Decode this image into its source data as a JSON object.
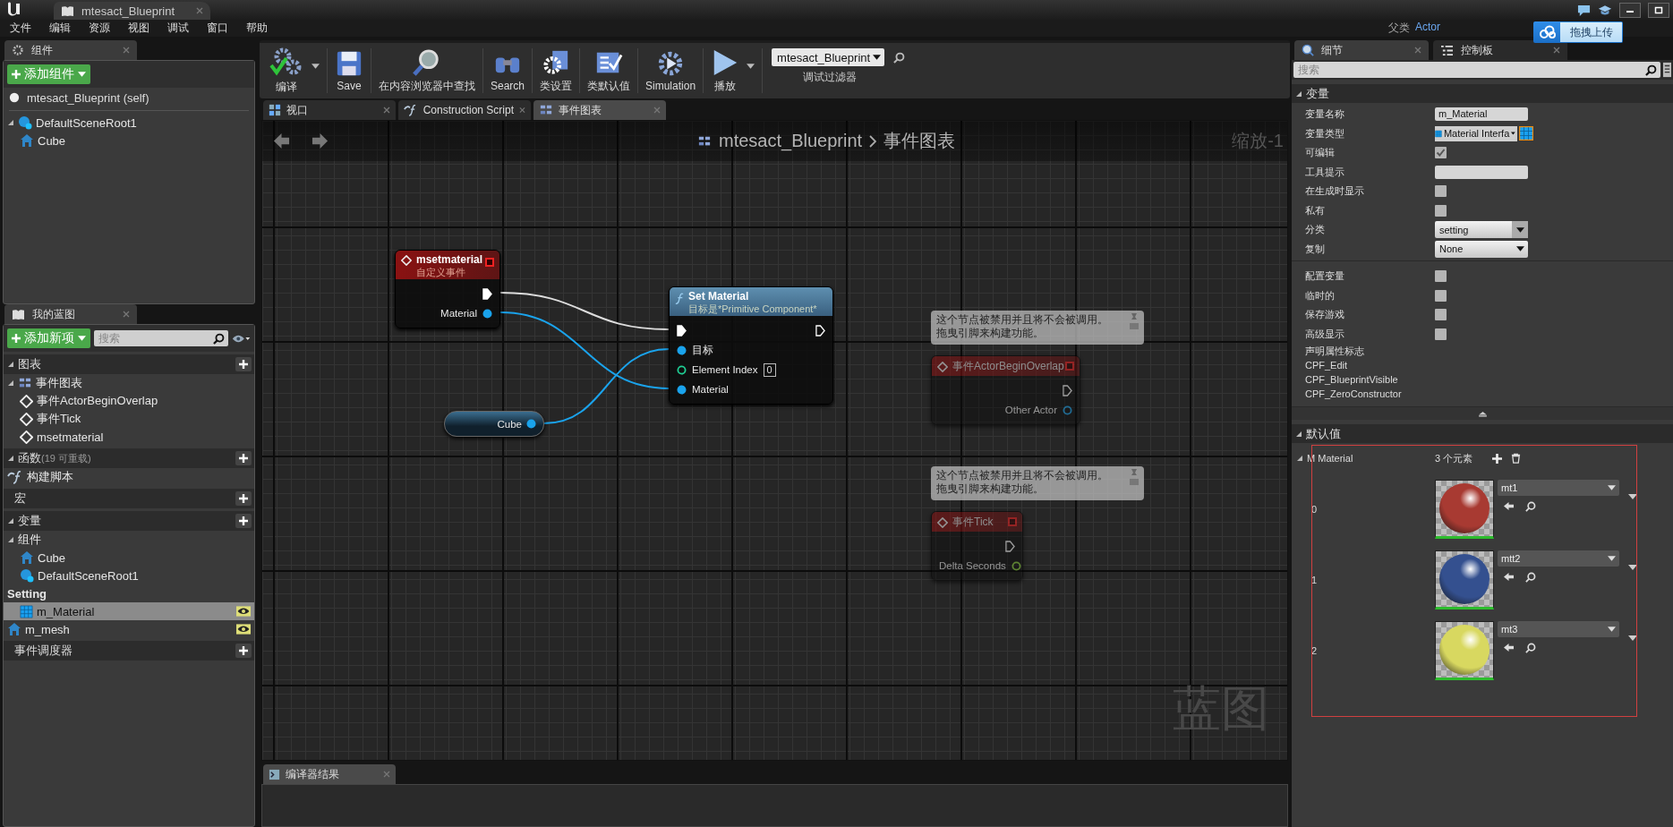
{
  "title_bar": {
    "document_tab": "mtesact_Blueprint"
  },
  "menu": [
    "文件",
    "编辑",
    "资源",
    "视图",
    "调试",
    "窗口",
    "帮助"
  ],
  "parent_class": {
    "label": "父类",
    "value": "Actor"
  },
  "upload_widget": {
    "label": "拖拽上传"
  },
  "components": {
    "tab": "组件",
    "add_button": "添加组件",
    "self_item": "mtesact_Blueprint (self)",
    "tree": [
      {
        "label": "DefaultSceneRoot1",
        "kind": "scene",
        "expanded": true,
        "selected": false,
        "children": [
          {
            "label": "Cube",
            "kind": "mesh",
            "selected": false
          }
        ]
      }
    ]
  },
  "my_blueprint": {
    "tab": "我的蓝图",
    "add_button": "添加新项",
    "search": {
      "placeholder": "搜索"
    },
    "sections": [
      {
        "title": "图表",
        "expanded": true,
        "rows": [
          {
            "label": "事件图表",
            "kind": "graph",
            "expanded": true,
            "selected": false,
            "children": [
              {
                "label": "事件ActorBeginOverlap",
                "kind": "event",
                "selected": false
              },
              {
                "label": "事件Tick",
                "kind": "event",
                "selected": false
              },
              {
                "label": "msetmaterial",
                "kind": "custom-event",
                "selected": false
              }
            ]
          }
        ]
      },
      {
        "title": "函数",
        "note": "(19 可重载)",
        "expanded": true,
        "rows": [
          {
            "label": "构建脚本",
            "kind": "function",
            "selected": false
          }
        ]
      },
      {
        "title": "宏"
      },
      {
        "title": "变量",
        "expanded": true,
        "rows": [
          {
            "label": "组件",
            "kind": "category",
            "expanded": true,
            "children": [
              {
                "label": "Cube",
                "kind": "mesh",
                "selected": false,
                "exposed": false
              },
              {
                "label": "DefaultSceneRoot1",
                "kind": "scene",
                "selected": false,
                "exposed": false
              }
            ]
          },
          {
            "label": "Setting",
            "kind": "user-category",
            "children": [
              {
                "label": "m_Material",
                "kind": "material",
                "selected": true,
                "exposed": true
              }
            ]
          },
          {
            "label": "m_mesh",
            "kind": "mesh",
            "selected": false,
            "exposed": true
          }
        ]
      },
      {
        "title": "事件调度器"
      }
    ]
  },
  "toolbar": {
    "buttons": [
      {
        "label": "编译",
        "kind": "compile",
        "has_menu": true
      },
      {
        "label": "Save",
        "kind": "save",
        "has_menu": false
      },
      {
        "label": "在内容浏览器中查找",
        "kind": "browse",
        "has_menu": false
      },
      {
        "label": "Search",
        "kind": "search",
        "has_menu": false
      },
      {
        "label": "类设置",
        "kind": "class-settings",
        "has_menu": false
      },
      {
        "label": "类默认值",
        "kind": "class-defaults",
        "has_menu": false
      },
      {
        "label": "Simulation",
        "kind": "simulation",
        "has_menu": false
      },
      {
        "label": "播放",
        "kind": "play",
        "has_menu": true
      }
    ],
    "debug_filter": {
      "value": "mtesact_Blueprint",
      "label": "调试过滤器"
    }
  },
  "document_tabs": [
    {
      "label": "视口",
      "kind": "viewport",
      "selected": false
    },
    {
      "label": "Construction Script",
      "kind": "function",
      "selected": false
    },
    {
      "label": "事件图表",
      "kind": "graph",
      "selected": true
    }
  ],
  "graph": {
    "breadcrumb": [
      "mtesact_Blueprint",
      "事件图表"
    ],
    "zoom": "缩放-1",
    "corner_label": "蓝图",
    "nodes": [
      {
        "kind": "custom-event",
        "disabled": false,
        "title": "msetmaterial",
        "subtitle": "自定义事件",
        "outputs": [
          {
            "kind": "exec",
            "connected": true
          },
          {
            "kind": "object",
            "label": "Material",
            "connected": true
          }
        ]
      },
      {
        "kind": "function",
        "disabled": false,
        "title": "Set Material",
        "subtitle": "目标是*Primitive Component*",
        "inputs": [
          {
            "kind": "exec",
            "connected": true
          },
          {
            "kind": "object",
            "label": "目标",
            "connected": true
          },
          {
            "kind": "int",
            "label": "Element Index",
            "value": "0",
            "connected": false
          },
          {
            "kind": "object",
            "label": "Material",
            "connected": true
          }
        ],
        "outputs": [
          {
            "kind": "exec",
            "connected": false
          }
        ]
      },
      {
        "kind": "variable",
        "disabled": false,
        "outputs": [
          {
            "kind": "object",
            "label": "Cube",
            "connected": true
          }
        ]
      },
      {
        "kind": "event",
        "disabled": true,
        "comment": [
          "这个节点被禁用并且将不会被调用。",
          "拖曳引脚来构建功能。"
        ],
        "title": "事件ActorBeginOverlap",
        "outputs": [
          {
            "kind": "exec",
            "connected": false
          },
          {
            "kind": "object",
            "label": "Other Actor",
            "connected": false
          }
        ]
      },
      {
        "kind": "event",
        "disabled": true,
        "comment": [
          "这个节点被禁用并且将不会被调用。",
          "拖曳引脚来构建功能。"
        ],
        "title": "事件Tick",
        "outputs": [
          {
            "kind": "exec",
            "connected": false
          },
          {
            "kind": "float",
            "label": "Delta Seconds",
            "connected": false
          }
        ]
      }
    ]
  },
  "compiler_results": {
    "tab": "编译器结果"
  },
  "details": {
    "tabs": [
      {
        "label": "细节",
        "kind": "details",
        "selected": true
      },
      {
        "label": "控制板",
        "kind": "palette",
        "selected": false
      }
    ],
    "search": {
      "placeholder": "搜索"
    },
    "variable_section": {
      "title": "变量",
      "expanded": true,
      "properties": [
        {
          "label": "变量名称",
          "kind": "text",
          "value": "m_Material"
        },
        {
          "label": "变量类型",
          "kind": "type",
          "value": "Material Interfa"
        },
        {
          "label": "可编辑",
          "kind": "checkbox",
          "checked": true
        },
        {
          "label": "工具提示",
          "kind": "text"
        },
        {
          "label": "在生成时显示",
          "kind": "checkbox",
          "checked": false
        },
        {
          "label": "私有",
          "kind": "checkbox",
          "checked": false
        },
        {
          "label": "分类",
          "kind": "combo",
          "value": "setting"
        },
        {
          "label": "复制",
          "kind": "dropdown",
          "value": "None"
        }
      ],
      "advanced_properties": [
        {
          "label": "配置变量",
          "kind": "checkbox",
          "checked": false
        },
        {
          "label": "临时的",
          "kind": "checkbox",
          "checked": false
        },
        {
          "label": "保存游戏",
          "kind": "checkbox",
          "checked": false
        },
        {
          "label": "高级显示",
          "kind": "checkbox",
          "checked": false
        },
        {
          "label": "声明属性标志",
          "kind": "label"
        },
        {
          "label": "CPF_Edit",
          "kind": "label"
        },
        {
          "label": "CPF_BlueprintVisible",
          "kind": "label"
        },
        {
          "label": "CPF_ZeroConstructor",
          "kind": "label"
        }
      ]
    },
    "defaults_section": {
      "title": "默认值",
      "expanded": true,
      "array": {
        "label": "M Material",
        "expanded": true,
        "count": "3 个元素",
        "elements": [
          {
            "index": "0",
            "asset": "mt1",
            "color": "#a83a32"
          },
          {
            "index": "1",
            "asset": "mtt2",
            "color": "#34508f"
          },
          {
            "index": "2",
            "asset": "mt3",
            "color": "#d8d860"
          }
        ]
      }
    }
  }
}
